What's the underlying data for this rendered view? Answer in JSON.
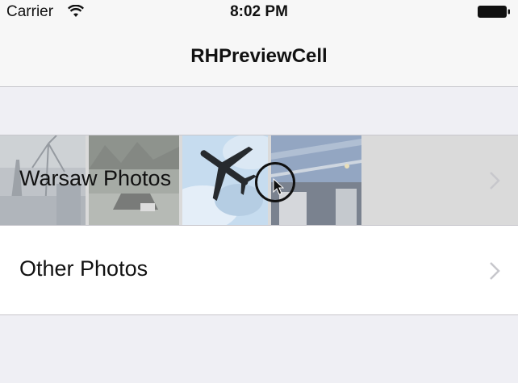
{
  "status_bar": {
    "carrier": "Carrier",
    "time": "8:02 PM",
    "wifi_icon": "wifi-icon",
    "battery_icon": "battery-full-icon"
  },
  "nav": {
    "title": "RHPreviewCell"
  },
  "table": {
    "rows": [
      {
        "label": "Warsaw Photos",
        "state": "highlighted",
        "thumbnails": [
          "street-photo",
          "car-photo",
          "airplane-photo",
          "building-photo"
        ],
        "selected_thumbnail": "airplane-photo"
      },
      {
        "label": "Other Photos",
        "state": "normal"
      }
    ],
    "accessory_icon": "chevron-right-icon"
  },
  "colors": {
    "background": "#efeff4",
    "bar": "#f7f7f7",
    "separator": "#c8c7cc",
    "highlight": "#dadada",
    "chevron": "#c7c7cc"
  }
}
